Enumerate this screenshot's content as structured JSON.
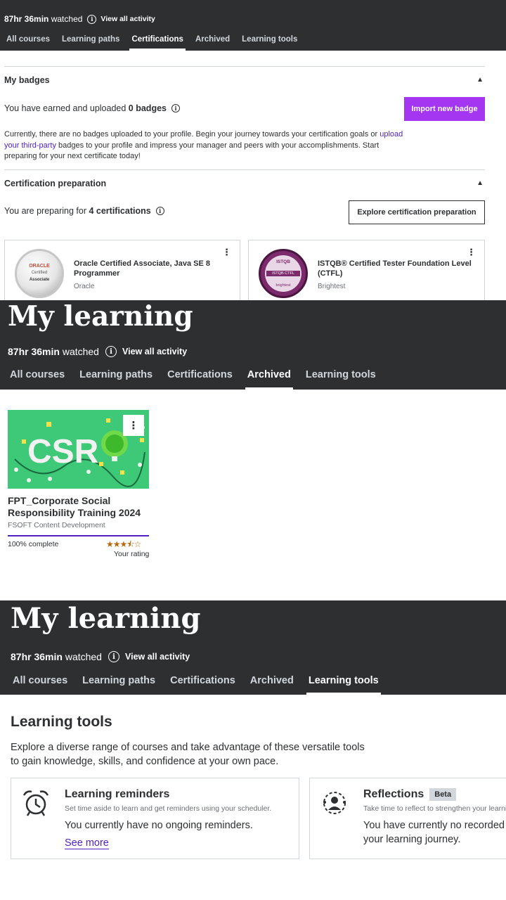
{
  "sections": [
    {
      "watched_time": "87hr 36min",
      "watched_suffix": "watched",
      "view_activity": "View all activity",
      "tabs": [
        "All courses",
        "Learning paths",
        "Certifications",
        "Archived",
        "Learning tools"
      ],
      "active_tab": "Certifications"
    },
    {
      "title": "My learning",
      "watched_time": "87hr 36min",
      "watched_suffix": "watched",
      "view_activity": "View all activity",
      "tabs": [
        "All courses",
        "Learning paths",
        "Certifications",
        "Archived",
        "Learning tools"
      ],
      "active_tab": "Archived"
    },
    {
      "title": "My learning",
      "watched_time": "87hr 36min",
      "watched_suffix": "watched",
      "view_activity": "View all activity",
      "tabs": [
        "All courses",
        "Learning paths",
        "Certifications",
        "Archived",
        "Learning tools"
      ],
      "active_tab": "Learning tools"
    }
  ],
  "badges": {
    "title": "My badges",
    "earned_prefix": "You have earned and uploaded",
    "earned_count": "0 badges",
    "import_button": "Import new badge",
    "para_start": "Currently, there are no badges uploaded to your profile. Begin your journey towards your certification goals or",
    "para_link": "upload your third-party",
    "para_end": "badges to your profile and impress your manager and peers with your accomplishments. Start preparing for your next certificate today!"
  },
  "cert_prep": {
    "title": "Certification preparation",
    "preparing_prefix": "You are preparing for",
    "preparing_count": "4 certifications",
    "explore_button": "Explore certification preparation",
    "cards": [
      {
        "title": "Oracle Certified Associate, Java SE 8 Programmer",
        "org": "Oracle",
        "logo_top": "ORACLE",
        "logo_mid": "Certified",
        "logo_bottom": "Associate"
      },
      {
        "title": "ISTQB® Certified Tester Foundation Level (CTFL)",
        "org": "Brightest",
        "logo_top": "ISTQB",
        "logo_mid": "ISTQB CTFL",
        "logo_bottom": "brightest"
      }
    ]
  },
  "archived_course": {
    "thumb_text": "CSR",
    "title": "FPT_Corporate Social Responsibility Training 2024",
    "instructor": "FSOFT Content Development",
    "progress": 1.0,
    "complete_label": "100% complete",
    "rating_stars": "★★★⯪☆",
    "rating_label": "Your rating"
  },
  "learning_tools": {
    "title": "Learning tools",
    "description": "Explore a diverse range of courses and take advantage of these versatile tools to gain knowledge, skills, and confidence at your own pace.",
    "cards": [
      {
        "title": "Learning reminders",
        "subtitle": "Set time aside to learn and get reminders using your scheduler.",
        "status": "You currently have no ongoing reminders.",
        "link": "See more"
      },
      {
        "title": "Reflections",
        "badge": "Beta",
        "subtitle": "Take time to reflect to strengthen your learning",
        "status": "You have currently no recorded reflections on your learning journey."
      }
    ]
  },
  "colors": {
    "dark_bg": "#2d2f31",
    "accent_purple": "#a435f0",
    "link_purple": "#5022c3",
    "star": "#b4690e",
    "thumb_green": "#3ec979"
  }
}
